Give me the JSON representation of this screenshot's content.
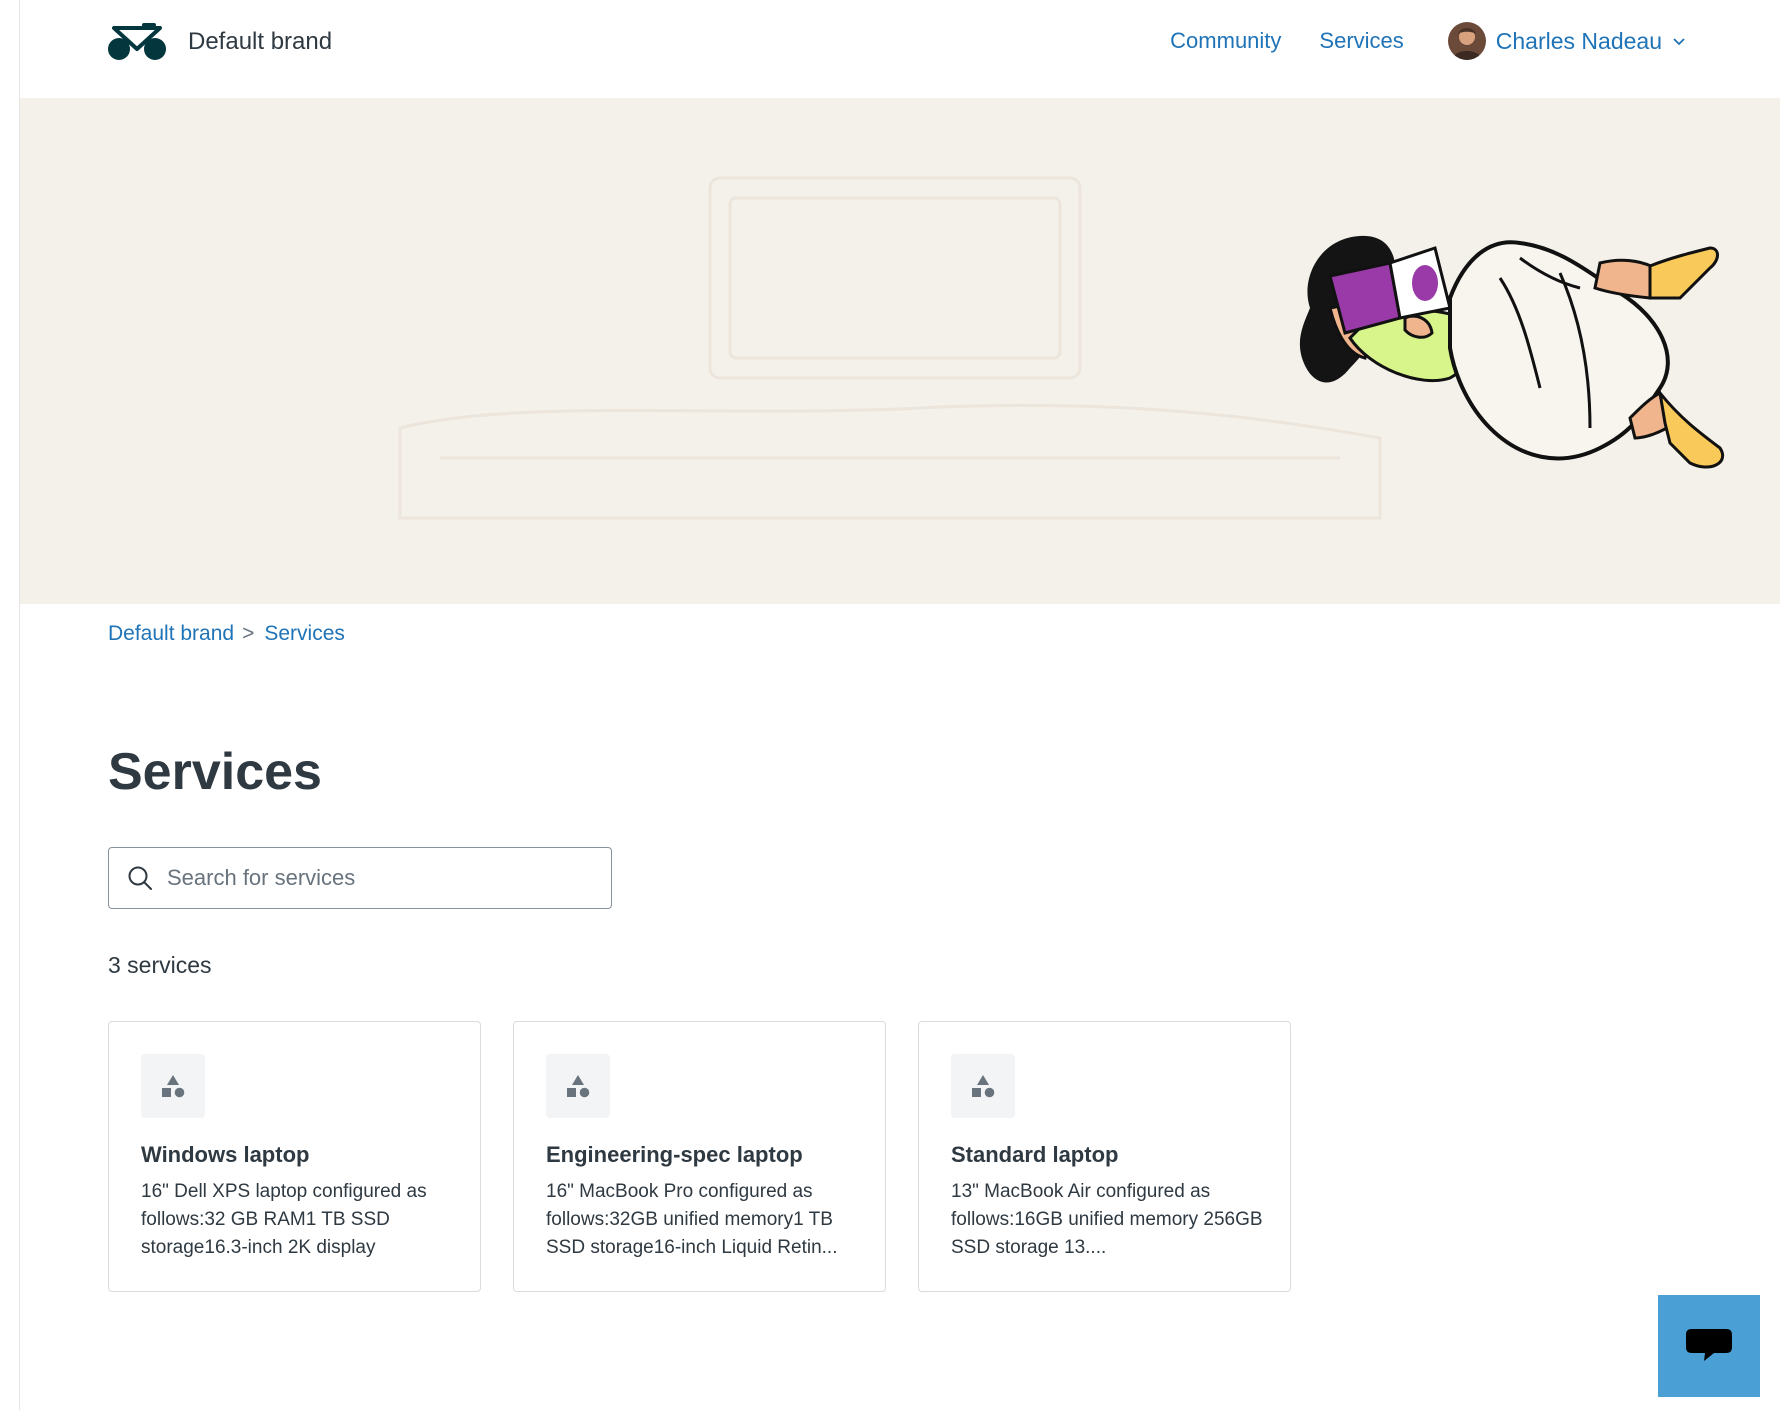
{
  "header": {
    "brand_name": "Default brand",
    "nav": {
      "community": "Community",
      "services": "Services"
    },
    "user": {
      "name": "Charles Nadeau"
    }
  },
  "breadcrumb": {
    "home": "Default brand",
    "separator": ">",
    "current": "Services"
  },
  "page": {
    "title": "Services"
  },
  "search": {
    "placeholder": "Search for services",
    "value": ""
  },
  "results": {
    "count_label": "3 services"
  },
  "cards": [
    {
      "title": "Windows laptop",
      "description": "16\" Dell XPS laptop configured as follows:32 GB RAM1 TB SSD storage16.3-inch 2K display"
    },
    {
      "title": "Engineering-spec laptop",
      "description": "16\" MacBook Pro configured as follows:32GB unified memory1 TB SSD storage16-inch Liquid Retin..."
    },
    {
      "title": "Standard laptop",
      "description": "13\" MacBook Air configured as follows:16GB unified memory 256GB SSD storage 13...."
    }
  ],
  "colors": {
    "link": "#1f73b7",
    "hero_bg": "#f4f0ea",
    "chat_button": "#4a9fd5",
    "text": "#2f3941",
    "brand_dark": "#03363d"
  },
  "icons": {
    "logo": "bicycle-logo-icon",
    "search": "search-icon",
    "chevron": "chevron-down-icon",
    "card": "shapes-icon",
    "chat": "chat-bubble-icon"
  }
}
